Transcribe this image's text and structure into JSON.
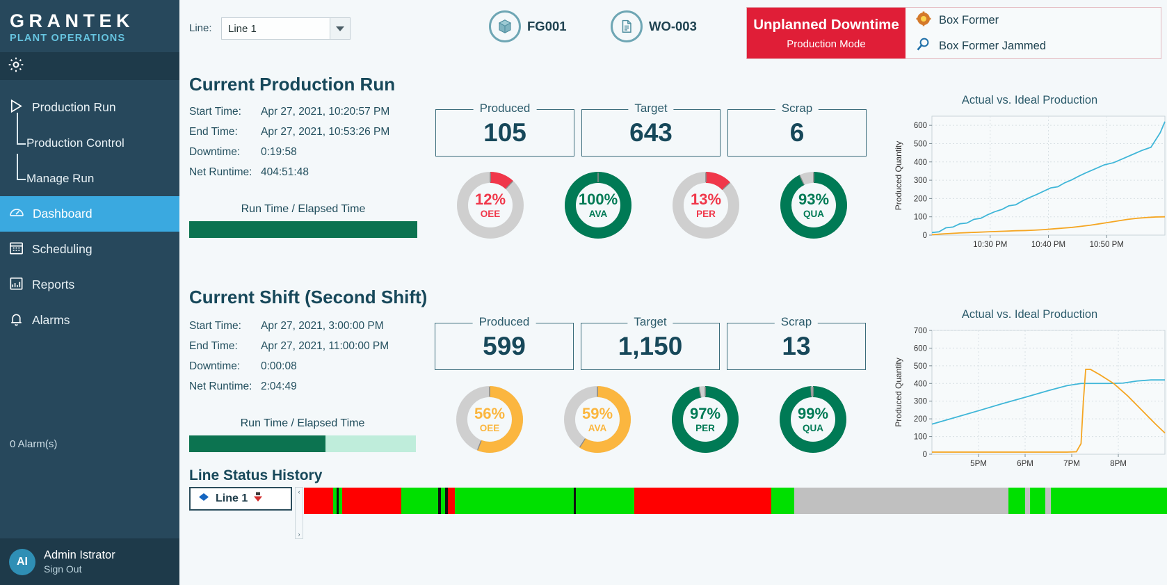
{
  "sidebar": {
    "brand_title": "GRANTEK",
    "brand_sub": "PLANT OPERATIONS",
    "gear_icon": "gear-icon",
    "items": [
      {
        "label": "Production Run",
        "icon": "play-icon",
        "type": "item",
        "active": false
      },
      {
        "label": "Production Control",
        "icon": "tree-branch",
        "type": "sub",
        "active": false
      },
      {
        "label": "Manage Run",
        "icon": "tree-branch",
        "type": "sub",
        "active": false
      },
      {
        "label": "Dashboard",
        "icon": "gauge-icon",
        "type": "item",
        "active": true
      },
      {
        "label": "Scheduling",
        "icon": "calendar-icon",
        "type": "item",
        "active": false
      },
      {
        "label": "Reports",
        "icon": "bar-chart-icon",
        "type": "item",
        "active": false
      },
      {
        "label": "Alarms",
        "icon": "bell-icon",
        "type": "item",
        "active": false
      }
    ],
    "alarm_count": "0 Alarm(s)",
    "user_initials": "AI",
    "user_name": "Admin Istrator",
    "sign_out": "Sign Out"
  },
  "topbar": {
    "line_label": "Line:",
    "line_value": "Line 1",
    "line_options": [
      "Line 1"
    ],
    "product_chip": {
      "icon": "cube-icon",
      "label": "FG001"
    },
    "workorder_chip": {
      "icon": "document-icon",
      "label": "WO-003"
    },
    "status": {
      "title": "Unplanned Downtime",
      "subtitle": "Production Mode",
      "color": "#e01e37",
      "reasons": [
        {
          "icon": "gear-icon",
          "label": "Box Former"
        },
        {
          "icon": "magnifier-icon",
          "label": "Box Former Jammed"
        }
      ]
    }
  },
  "production_run": {
    "title": "Current Production Run",
    "fields": [
      {
        "key": "Start Time:",
        "value": "Apr 27, 2021, 10:20:57 PM"
      },
      {
        "key": "End Time:",
        "value": "Apr 27, 2021, 10:53:26 PM"
      },
      {
        "key": "Downtime:",
        "value": "0:19:58"
      },
      {
        "key": "Net Runtime:",
        "value": "404:51:48"
      }
    ],
    "runtime_label": "Run Time / Elapsed Time",
    "runtime_percent": 100,
    "kpis": [
      {
        "caption": "Produced",
        "value": "105"
      },
      {
        "caption": "Target",
        "value": "643"
      },
      {
        "caption": "Scrap",
        "value": "6"
      }
    ],
    "gauges": [
      {
        "name": "OEE",
        "value": 12,
        "text": "12%",
        "color": "#f0374a"
      },
      {
        "name": "AVA",
        "value": 100,
        "text": "100%",
        "color": "#007a55"
      },
      {
        "name": "PER",
        "value": 13,
        "text": "13%",
        "color": "#f0374a"
      },
      {
        "name": "QUA",
        "value": 93,
        "text": "93%",
        "color": "#007a55"
      }
    ]
  },
  "shift": {
    "title": "Current Shift  (Second Shift)",
    "fields": [
      {
        "key": "Start Time:",
        "value": "Apr 27, 2021, 3:00:00 PM"
      },
      {
        "key": "End Time:",
        "value": "Apr 27, 2021, 11:00:00 PM"
      },
      {
        "key": "Downtime:",
        "value": "0:00:08"
      },
      {
        "key": "Net Runtime:",
        "value": "2:04:49"
      }
    ],
    "runtime_label": "Run Time / Elapsed Time",
    "runtime_percent": 60,
    "kpis": [
      {
        "caption": "Produced",
        "value": "599"
      },
      {
        "caption": "Target",
        "value": "1,150"
      },
      {
        "caption": "Scrap",
        "value": "13"
      }
    ],
    "gauges": [
      {
        "name": "OEE",
        "value": 56,
        "text": "56%",
        "color": "#fbb63f"
      },
      {
        "name": "AVA",
        "value": 59,
        "text": "59%",
        "color": "#fbb63f"
      },
      {
        "name": "PER",
        "value": 97,
        "text": "97%",
        "color": "#007a55"
      },
      {
        "name": "QUA",
        "value": 99,
        "text": "99%",
        "color": "#007a55"
      }
    ]
  },
  "line_status_history": {
    "title": "Line Status History",
    "line_button": "Line 1",
    "segments": [
      {
        "color": "#ff0000",
        "width": 3.3
      },
      {
        "color": "#00e000",
        "width": 0.4
      },
      {
        "color": "#111111",
        "width": 0.25
      },
      {
        "color": "#00e000",
        "width": 0.4
      },
      {
        "color": "#ff0000",
        "width": 6.8
      },
      {
        "color": "#00e000",
        "width": 4.2
      },
      {
        "color": "#111111",
        "width": 0.3
      },
      {
        "color": "#00e000",
        "width": 0.5
      },
      {
        "color": "#111111",
        "width": 0.3
      },
      {
        "color": "#ff0000",
        "width": 0.8
      },
      {
        "color": "#00e000",
        "width": 13.6
      },
      {
        "color": "#111111",
        "width": 0.25
      },
      {
        "color": "#00e000",
        "width": 6.6
      },
      {
        "color": "#ff0000",
        "width": 15.7
      },
      {
        "color": "#00e000",
        "width": 2.6
      },
      {
        "color": "#c0c0c0",
        "width": 24.5
      },
      {
        "color": "#00e000",
        "width": 1.9
      },
      {
        "color": "#c0c0c0",
        "width": 0.5
      },
      {
        "color": "#00e000",
        "width": 1.8
      },
      {
        "color": "#c0c0c0",
        "width": 0.6
      },
      {
        "color": "#00e000",
        "width": 14.5
      }
    ]
  },
  "chart_data": [
    {
      "type": "line",
      "title": "Actual vs. Ideal Production",
      "xlabel": "",
      "ylabel": "Produced Quantity",
      "ylim": [
        0,
        650
      ],
      "yticks": [
        0,
        100,
        200,
        300,
        400,
        500,
        600
      ],
      "xticks": [
        "10:30 PM",
        "10:40 PM",
        "10:50 PM"
      ],
      "grid": true,
      "legend": "none",
      "series": [
        {
          "name": "Ideal",
          "color": "#3fb6d8",
          "x": [
            0,
            3,
            6,
            9,
            12,
            15,
            18,
            21,
            24,
            27,
            30,
            33,
            36,
            39,
            42,
            45,
            48,
            51,
            54,
            57,
            60,
            63,
            66,
            70,
            74,
            78,
            82,
            86,
            90,
            94,
            98,
            100
          ],
          "values": [
            14,
            18,
            40,
            44,
            62,
            66,
            86,
            92,
            112,
            128,
            140,
            160,
            166,
            188,
            206,
            222,
            240,
            258,
            264,
            286,
            302,
            322,
            340,
            362,
            384,
            396,
            418,
            440,
            462,
            480,
            560,
            620
          ]
        },
        {
          "name": "Actual",
          "color": "#f5a623",
          "x": [
            0,
            4,
            8,
            12,
            16,
            20,
            24,
            28,
            32,
            36,
            40,
            44,
            48,
            52,
            56,
            60,
            64,
            68,
            72,
            76,
            80,
            84,
            88,
            92,
            96,
            100
          ],
          "values": [
            2,
            6,
            9,
            12,
            14,
            16,
            18,
            20,
            22,
            24,
            25,
            27,
            30,
            34,
            38,
            42,
            48,
            54,
            62,
            70,
            78,
            86,
            92,
            96,
            99,
            100
          ]
        }
      ]
    },
    {
      "type": "line",
      "title": "Actual vs. Ideal Production",
      "xlabel": "",
      "ylabel": "Produced Quantity",
      "ylim": [
        0,
        700
      ],
      "yticks": [
        0,
        100,
        200,
        300,
        400,
        500,
        600,
        700
      ],
      "xticks": [
        "5PM",
        "6PM",
        "7PM",
        "8PM"
      ],
      "grid": true,
      "legend": "none",
      "series": [
        {
          "name": "Ideal",
          "color": "#3fb6d8",
          "x": [
            0,
            10,
            20,
            30,
            40,
            50,
            58,
            64,
            70,
            76,
            82,
            88,
            94,
            100
          ],
          "values": [
            170,
            208,
            246,
            285,
            322,
            360,
            388,
            400,
            400,
            400,
            402,
            414,
            420,
            420
          ]
        },
        {
          "name": "Actual",
          "color": "#f5a623",
          "x": [
            0,
            10,
            20,
            30,
            40,
            50,
            58,
            62,
            64,
            65,
            66,
            68,
            72,
            78,
            84,
            90,
            96,
            100
          ],
          "values": [
            12,
            12,
            12,
            12,
            12,
            12,
            12,
            14,
            60,
            300,
            480,
            480,
            450,
            400,
            330,
            250,
            170,
            120
          ]
        }
      ]
    }
  ]
}
